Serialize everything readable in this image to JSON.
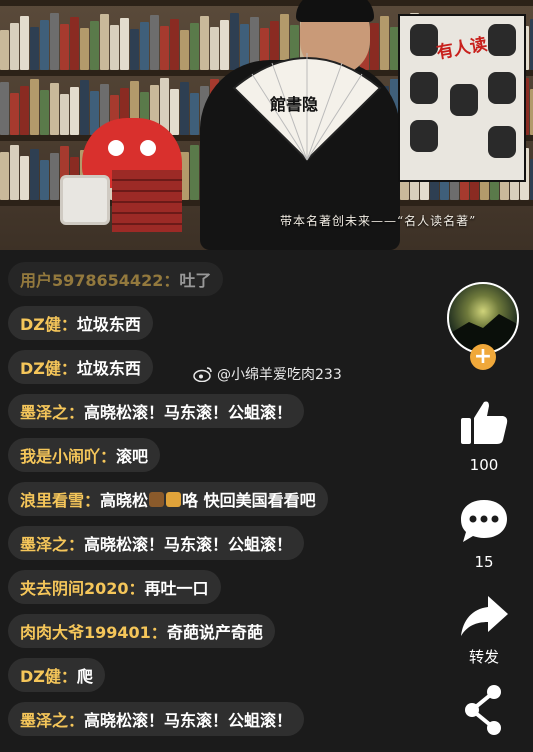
{
  "video": {
    "subtitle": "带本名著创未来——“名人读名著”",
    "fan_text": "館書隐",
    "poster_title": "有人读"
  },
  "comments": [
    {
      "user": "用户5978654422：",
      "text": "吐了",
      "faded": true
    },
    {
      "user": "DZ健：",
      "text": "垃圾东西"
    },
    {
      "user": "DZ健：",
      "text": "垃圾东西"
    },
    {
      "user": "墨泽之：",
      "text": "高晓松滚！马东滚！公蛆滚！"
    },
    {
      "user": "我是小闹吖：",
      "text": "滚吧"
    },
    {
      "user": "浪里看雪：",
      "text_before": "高晓松",
      "emojis": [
        "poop",
        "couple"
      ],
      "text_after": "咯 快回美国看看吧"
    },
    {
      "user": "墨泽之：",
      "text": "高晓松滚！马东滚！公蛆滚！"
    },
    {
      "user": "夹去阴间2020：",
      "text": "再吐一口"
    },
    {
      "user": "肉肉大爷199401：",
      "text": "奇葩说产奇葩"
    },
    {
      "user": "DZ健：",
      "text": "爬"
    },
    {
      "user": "墨泽之：",
      "text": "高晓松滚！马东滚！公蛆滚！"
    }
  ],
  "watermark": {
    "icon": "weibo-icon",
    "text": "@小绵羊爱吃肉233"
  },
  "rail": {
    "follow_symbol": "+",
    "like": {
      "icon": "thumbs-up-icon",
      "count": "100"
    },
    "comment": {
      "icon": "comment-icon",
      "count": "15"
    },
    "share": {
      "icon": "share-arrow-icon",
      "label": "转发"
    },
    "more": {
      "icon": "share-nodes-icon"
    }
  },
  "colors": {
    "username": "#f5c65a",
    "message": "#ffffff",
    "bubble": "rgba(255,255,255,0.09)",
    "follow": "#f0a83a",
    "background": "#1b1b1b"
  }
}
